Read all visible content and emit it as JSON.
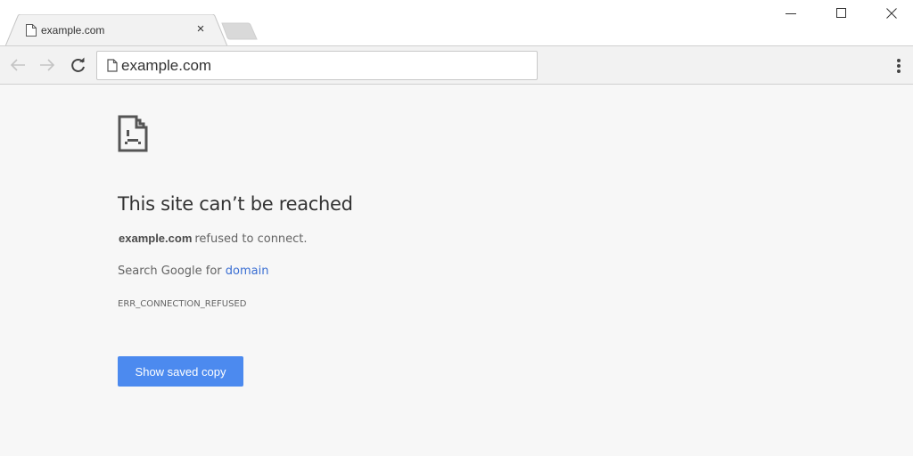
{
  "window": {
    "controls": {
      "minimize_icon": "minimize-icon",
      "maximize_icon": "maximize-icon",
      "close_icon": "close-icon"
    }
  },
  "tabs": [
    {
      "title": "example.com",
      "icon": "page-icon",
      "active": true,
      "close_label": "×"
    }
  ],
  "toolbar": {
    "back_icon": "arrow-left-icon",
    "forward_icon": "arrow-right-icon",
    "reload_icon": "reload-icon",
    "menu_icon": "kebab-menu-icon",
    "address": {
      "icon": "page-icon",
      "value": "example.com"
    }
  },
  "error_page": {
    "icon": "sad-page-icon",
    "heading": "This site can’t be reached",
    "host": "example.com",
    "message": "refused to connect.",
    "search_prefix": "Search Google for ",
    "search_link": "domain",
    "error_code": "ERR_CONNECTION_REFUSED",
    "button_label": "Show saved copy"
  },
  "colors": {
    "accent_button": "#4c8aef",
    "link": "#3b6fd3",
    "page_background": "#f7f7f7",
    "toolbar_background": "#f2f2f2"
  }
}
